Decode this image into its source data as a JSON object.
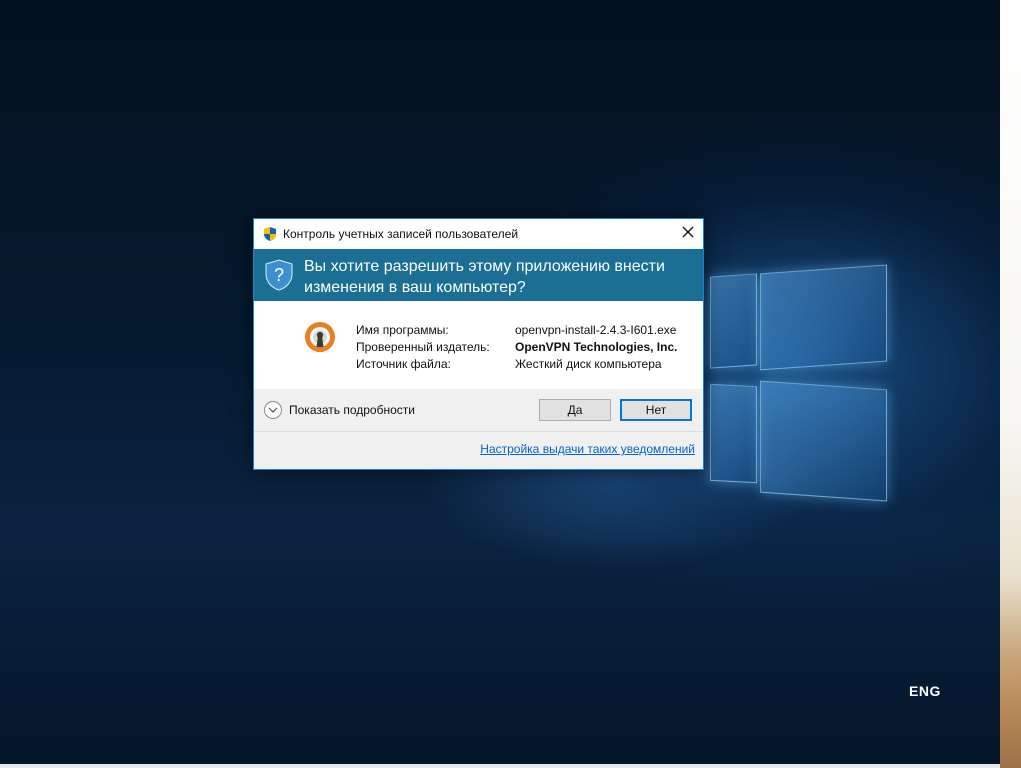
{
  "dialog": {
    "title": "Контроль учетных записей пользователей",
    "question": "Вы хотите разрешить этому приложению внести изменения в ваш компьютер?",
    "program_label": "Имя программы:",
    "program_value": "openvpn-install-2.4.3-I601.exe",
    "publisher_label": "Проверенный издатель:",
    "publisher_value": "OpenVPN Technologies, Inc.",
    "source_label": "Источник файла:",
    "source_value": "Жесткий диск компьютера",
    "details_label": "Показать подробности",
    "yes_label": "Да",
    "no_label": "Нет",
    "settings_link": "Настройка выдачи таких уведомлений"
  },
  "taskbar": {
    "language": "ENG"
  },
  "icons": {
    "title_icon": "uac-shield-icon",
    "banner_icon": "question-shield-icon",
    "app_icon": "openvpn-icon",
    "close_icon": "close-icon",
    "details_icon": "chevron-down-icon"
  },
  "colors": {
    "banner": "#1b6f95",
    "link": "#0066cc",
    "default_button_border": "#0078d7",
    "app_icon_orange": "#ea7e20"
  }
}
